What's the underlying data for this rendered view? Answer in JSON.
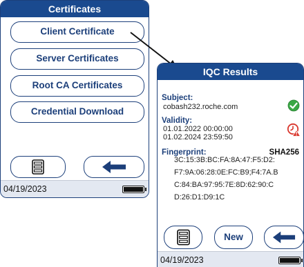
{
  "screen1": {
    "title": "Certificates",
    "menu": [
      "Client Certificate",
      "Server Certificates",
      "Root CA Certificates",
      "Credential Download"
    ],
    "date": "04/19/2023"
  },
  "screen2": {
    "title": "IQC Results",
    "subject_label": "Subject:",
    "subject_value": "cobash232.roche.com",
    "validity_label": "Validity:",
    "validity_from": "01.01.2022 00:00:00",
    "validity_to": "01.02.2024 23:59:50",
    "fingerprint_label": "Fingerprint:",
    "fingerprint_algo": "SHA256",
    "fingerprint_lines": [
      "3C:15:3B:BC:FA:8A:47:F5:D2:",
      "F7:9A:06:28:0E:FC:B9;F4:7A.B",
      "C:84:BA:97:95:7E:8D:62:90:C",
      "D:26:D1:D9:1C"
    ],
    "new_label": "New",
    "date": "04/19/2023"
  },
  "colors": {
    "navy": "#1a4a8f",
    "ok_green": "#3aa845",
    "warn_red": "#d9352b",
    "status_bar": "#e3e8f1"
  },
  "icons": {
    "subject_status": "check-circle-icon",
    "validity_status": "expired-clock-warning-icon",
    "list": "list-icon",
    "back": "back-arrow-icon"
  }
}
